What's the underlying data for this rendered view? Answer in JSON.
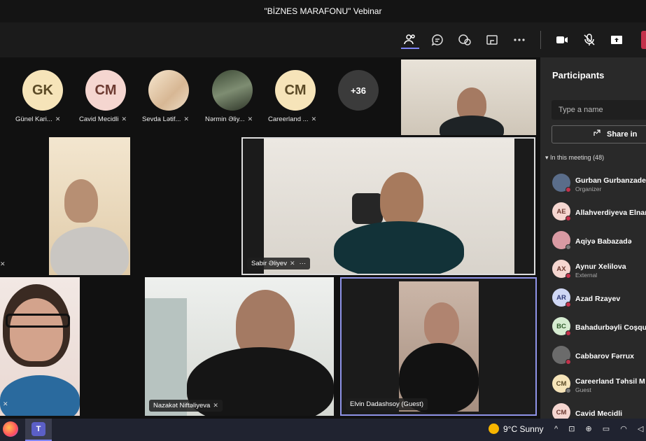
{
  "window": {
    "title": "\"BİZNES MARAFONU\" Vebinar"
  },
  "toolbar": {
    "icons": [
      "people-icon",
      "chat-icon",
      "reactions-icon",
      "share-tray-icon",
      "more-icon",
      "camera-icon",
      "mic-off-icon",
      "share-screen-icon"
    ]
  },
  "gallery": {
    "avatars": [
      {
        "initials": "GK",
        "name": "Günel Kari..."
      },
      {
        "initials": "CM",
        "name": "Cavid Mecidli"
      },
      {
        "initials": "",
        "name": "Sevda Lətif..."
      },
      {
        "initials": "",
        "name": "Nərmin Əliy..."
      },
      {
        "initials": "CM",
        "name": "Careerland ..."
      },
      {
        "initials": "+36",
        "name": ""
      }
    ],
    "tiles": {
      "featured": "Sabir Əliyev",
      "bottom_middle": "Nazakət Niftəliyeva",
      "bottom_right": "Elvin Dadashsoy (Guest)"
    }
  },
  "panel": {
    "title": "Participants",
    "search_placeholder": "Type a name",
    "share_label": "Share in",
    "section": "In this meeting (48)",
    "participants": [
      {
        "initials": "",
        "name": "Gurban Gurbanzade",
        "sub": "Organizer",
        "bg": "#5a6d8a"
      },
      {
        "initials": "AE",
        "name": "Allahverdiyeva Elnar",
        "sub": "",
        "bg": "#f5d6d0"
      },
      {
        "initials": "",
        "name": "Aqiyə Babazadə",
        "sub": "",
        "bg": "#d99aa3"
      },
      {
        "initials": "AX",
        "name": "Aynur Xelilova",
        "sub": "External",
        "bg": "#f5d6d0"
      },
      {
        "initials": "AR",
        "name": "Azad Rzayev",
        "sub": "",
        "bg": "#cfd7f4"
      },
      {
        "initials": "BC",
        "name": "Bahadurbəyli Coşqu",
        "sub": "",
        "bg": "#d6ecd1"
      },
      {
        "initials": "",
        "name": "Cabbarov Fərrux",
        "sub": "",
        "bg": "#6b6b6b"
      },
      {
        "initials": "CM",
        "name": "Careerland Təhsil M",
        "sub": "Guest",
        "bg": "#f6e4b9"
      },
      {
        "initials": "CM",
        "name": "Cavid Mecidli",
        "sub": "",
        "bg": "#f5d6d0"
      }
    ]
  },
  "taskbar": {
    "weather": "9°C Sunny",
    "tray": "^ ⊡ ⊕ ▭ ◠ ◁ AZ"
  }
}
